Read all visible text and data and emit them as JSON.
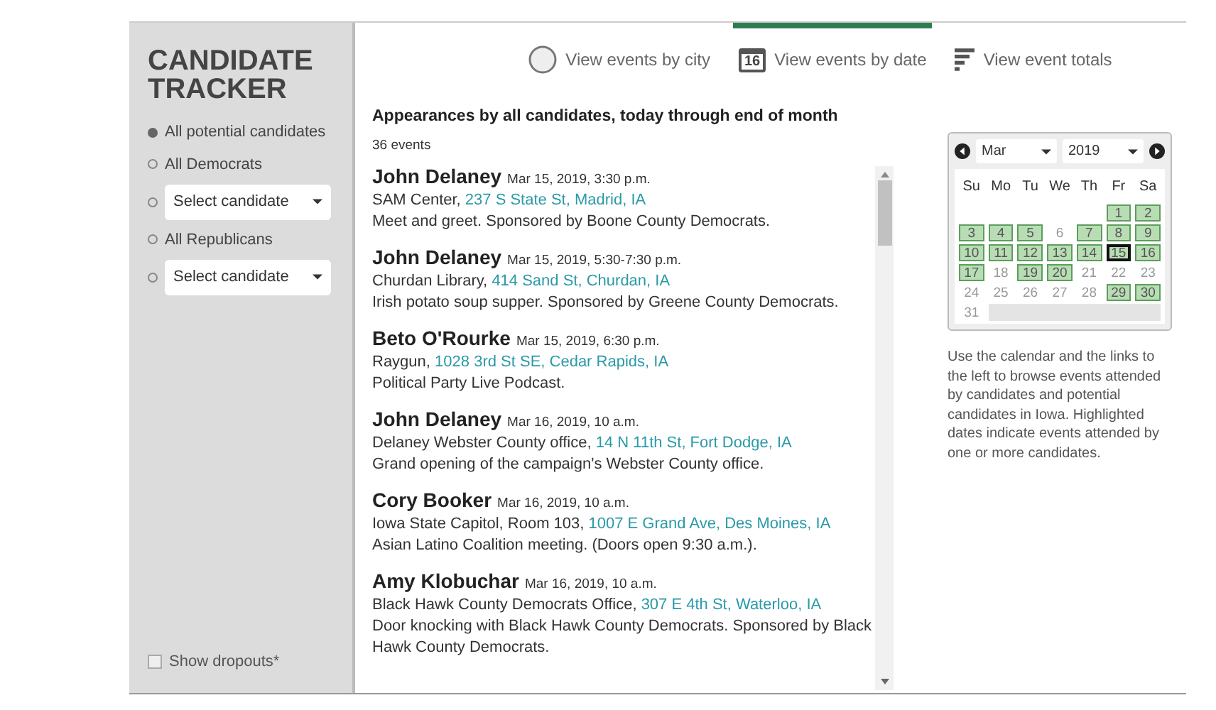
{
  "sidebar": {
    "title": "CANDIDATE TRACKER",
    "options": [
      {
        "kind": "radio",
        "label": "All potential candidates",
        "selected": true
      },
      {
        "kind": "radio",
        "label": "All Democrats",
        "selected": false
      },
      {
        "kind": "select",
        "value": "Select candidate",
        "selected": false
      },
      {
        "kind": "radio",
        "label": "All Republicans",
        "selected": false
      },
      {
        "kind": "select",
        "value": "Select candidate",
        "selected": false
      }
    ],
    "show_dropouts": {
      "label": "Show dropouts*",
      "checked": false
    }
  },
  "tabs": [
    {
      "kind": "city",
      "label": "View events by city",
      "selected": false
    },
    {
      "kind": "date",
      "icon_text": "16",
      "label": "View events by date",
      "selected": true
    },
    {
      "kind": "totals",
      "label": "View event totals",
      "selected": false
    }
  ],
  "list": {
    "heading": "Appearances by all candidates, today through end of month",
    "count": "36 events",
    "events": [
      {
        "name": "John Delaney",
        "when": "Mar 15, 2019, 3:30 p.m.",
        "venue": "SAM Center,",
        "address": "237 S State St, Madrid, IA",
        "description": "Meet and greet. Sponsored by Boone County Democrats."
      },
      {
        "name": "John Delaney",
        "when": "Mar 15, 2019, 5:30-7:30 p.m.",
        "venue": "Churdan Library,",
        "address": "414 Sand St, Churdan, IA",
        "description": "Irish potato soup supper. Sponsored by Greene County Democrats."
      },
      {
        "name": "Beto O'Rourke",
        "when": "Mar 15, 2019, 6:30 p.m.",
        "venue": "Raygun,",
        "address": "1028 3rd St SE, Cedar Rapids, IA",
        "description": "Political Party Live Podcast."
      },
      {
        "name": "John Delaney",
        "when": "Mar 16, 2019, 10 a.m.",
        "venue": "Delaney Webster County office,",
        "address": "14 N 11th St, Fort Dodge, IA",
        "description": "Grand opening of the campaign's Webster County office."
      },
      {
        "name": "Cory Booker",
        "when": "Mar 16, 2019, 10 a.m.",
        "venue": "Iowa State Capitol, Room 103,",
        "address": "1007 E Grand Ave, Des Moines, IA",
        "description": "Asian Latino Coalition meeting. (Doors open 9:30 a.m.)."
      },
      {
        "name": "Amy Klobuchar",
        "when": "Mar 16, 2019, 10 a.m.",
        "venue": "Black Hawk County Democrats Office,",
        "address": "307 E 4th St, Waterloo, IA",
        "description": "Door knocking with Black Hawk County Democrats. Sponsored by Black Hawk County Democrats."
      }
    ]
  },
  "calendar": {
    "month": "Mar",
    "year": "2019",
    "weekdays": [
      "Su",
      "Mo",
      "Tu",
      "We",
      "Th",
      "Fr",
      "Sa"
    ],
    "weeks": [
      [
        {
          "day": "1",
          "highlighted": true,
          "today": false
        },
        {
          "day": "2",
          "highlighted": true,
          "today": false
        }
      ],
      [
        {
          "day": "3",
          "highlighted": true,
          "today": false
        },
        {
          "day": "4",
          "highlighted": true,
          "today": false
        },
        {
          "day": "5",
          "highlighted": true,
          "today": false
        },
        {
          "day": "6",
          "highlighted": false,
          "today": false
        },
        {
          "day": "7",
          "highlighted": true,
          "today": false
        },
        {
          "day": "8",
          "highlighted": true,
          "today": false
        },
        {
          "day": "9",
          "highlighted": true,
          "today": false
        }
      ],
      [
        {
          "day": "10",
          "highlighted": true,
          "today": false
        },
        {
          "day": "11",
          "highlighted": true,
          "today": false
        },
        {
          "day": "12",
          "highlighted": true,
          "today": false
        },
        {
          "day": "13",
          "highlighted": true,
          "today": false
        },
        {
          "day": "14",
          "highlighted": true,
          "today": false
        },
        {
          "day": "15",
          "highlighted": true,
          "today": true
        },
        {
          "day": "16",
          "highlighted": true,
          "today": false
        }
      ],
      [
        {
          "day": "17",
          "highlighted": true,
          "today": false
        },
        {
          "day": "18",
          "highlighted": false,
          "today": false
        },
        {
          "day": "19",
          "highlighted": true,
          "today": false
        },
        {
          "day": "20",
          "highlighted": true,
          "today": false
        },
        {
          "day": "21",
          "highlighted": false,
          "today": false
        },
        {
          "day": "22",
          "highlighted": false,
          "today": false
        },
        {
          "day": "23",
          "highlighted": false,
          "today": false
        }
      ],
      [
        {
          "day": "24",
          "highlighted": false,
          "today": false
        },
        {
          "day": "25",
          "highlighted": false,
          "today": false
        },
        {
          "day": "26",
          "highlighted": false,
          "today": false
        },
        {
          "day": "27",
          "highlighted": false,
          "today": false
        },
        {
          "day": "28",
          "highlighted": false,
          "today": false
        },
        {
          "day": "29",
          "highlighted": true,
          "today": false
        },
        {
          "day": "30",
          "highlighted": true,
          "today": false
        }
      ],
      [
        {
          "day": "31",
          "highlighted": false,
          "today": false
        }
      ]
    ]
  },
  "help": "Use the calendar and the links to the left to browse events attended by candidates and potential candidates in Iowa. Highlighted dates indicate events attended by one or more candidates."
}
